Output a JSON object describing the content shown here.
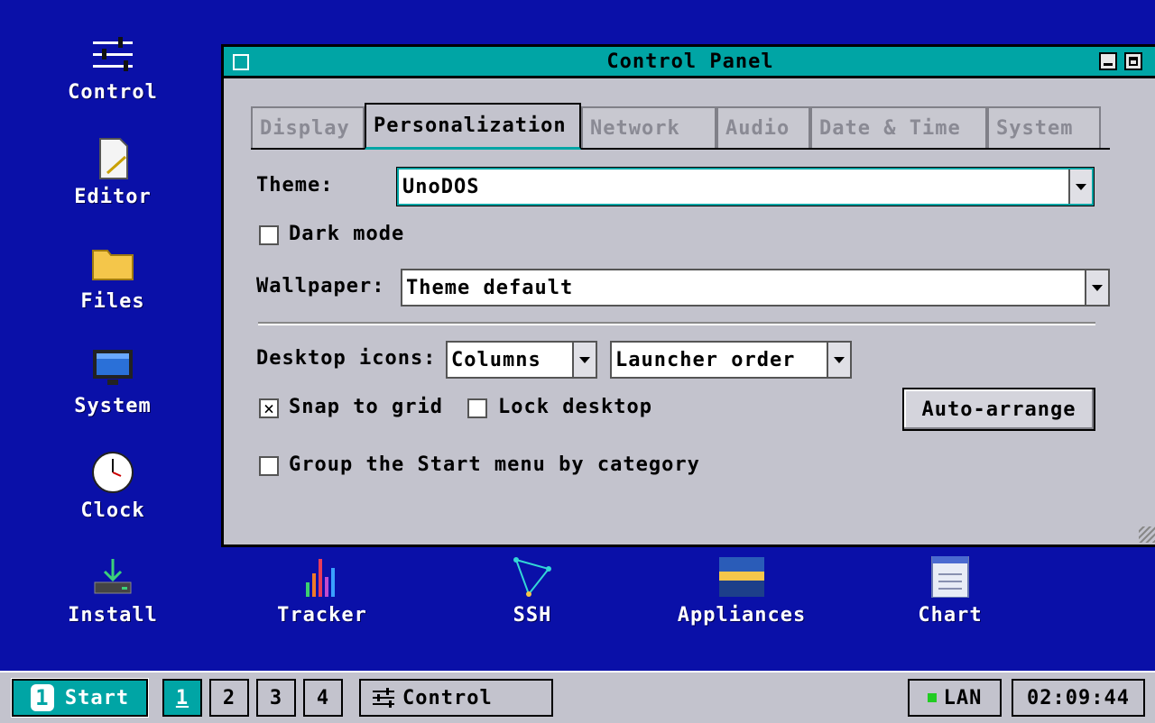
{
  "desktop": {
    "icons": [
      {
        "label": "Control"
      },
      {
        "label": "Editor"
      },
      {
        "label": "Files"
      },
      {
        "label": "System"
      },
      {
        "label": "Clock"
      },
      {
        "label": "Install"
      },
      {
        "label": "Tracker"
      },
      {
        "label": "SSH"
      },
      {
        "label": "Appliances"
      },
      {
        "label": "Chart"
      }
    ]
  },
  "window": {
    "title": "Control Panel",
    "tabs": [
      {
        "label": "Display"
      },
      {
        "label": "Personalization",
        "active": true
      },
      {
        "label": "Network"
      },
      {
        "label": "Audio"
      },
      {
        "label": "Date & Time"
      },
      {
        "label": "System"
      }
    ],
    "theme": {
      "label": "Theme:",
      "value": "UnoDOS"
    },
    "dark_mode": {
      "label": "Dark mode",
      "checked": false
    },
    "wallpaper": {
      "label": "Wallpaper:",
      "value": "Theme default"
    },
    "desktop_icons": {
      "label": "Desktop icons:",
      "layout": "Columns",
      "order": "Launcher order"
    },
    "snap_to_grid": {
      "label": "Snap to grid",
      "checked": true,
      "mark": "×"
    },
    "lock_desktop": {
      "label": "Lock desktop",
      "checked": false
    },
    "auto_arrange_label": "Auto-arrange",
    "group_start": {
      "label": "Group the Start menu by category",
      "checked": false
    }
  },
  "taskbar": {
    "start_num": "1",
    "start_label": "Start",
    "workspaces": [
      "1",
      "2",
      "3",
      "4"
    ],
    "active_workspace": "1",
    "task_label": "Control",
    "network_label": "LAN",
    "clock": "02:09:44"
  },
  "colors": {
    "desktop": "#0a10a8",
    "accent": "#00a5a5",
    "window": "#c3c3cd",
    "status_led": "#22cc22"
  }
}
